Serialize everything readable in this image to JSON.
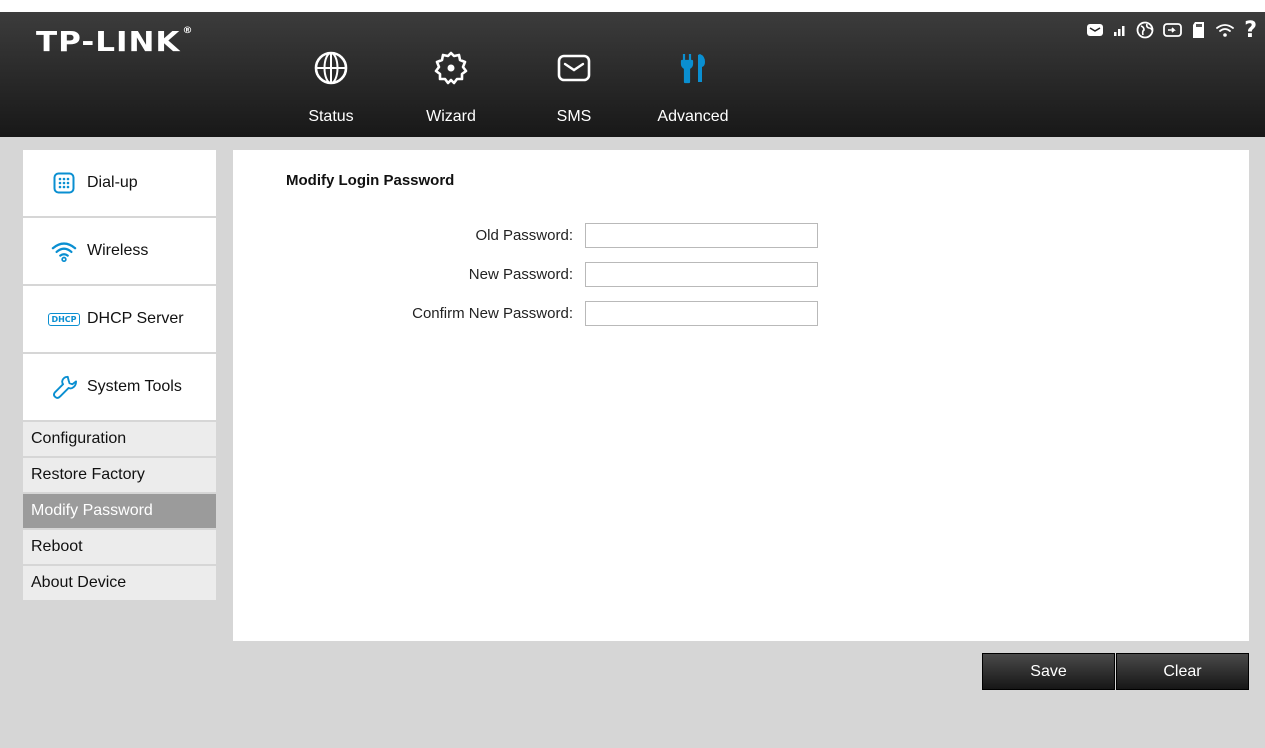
{
  "brand": {
    "logo_text": "TP-LINK",
    "logo_mark": "®"
  },
  "nav": [
    {
      "id": "status",
      "label": "Status",
      "icon": "globe-icon"
    },
    {
      "id": "wizard",
      "label": "Wizard",
      "icon": "gear-icon"
    },
    {
      "id": "sms",
      "label": "SMS",
      "icon": "envelope-icon"
    },
    {
      "id": "advanced",
      "label": "Advanced",
      "icon": "tools-icon",
      "active": true
    }
  ],
  "status_icons": [
    "message-icon",
    "signal-icon",
    "internet-icon",
    "battery-icon",
    "sd-card-icon",
    "wifi-icon",
    "help-icon"
  ],
  "sidebar": {
    "items": [
      {
        "label": "Dial-up",
        "icon": "dialpad-icon"
      },
      {
        "label": "Wireless",
        "icon": "wifi-icon"
      },
      {
        "label": "DHCP Server",
        "icon": "dhcp-icon",
        "icon_text": "DHCP"
      },
      {
        "label": "System Tools",
        "icon": "wrench-icon"
      }
    ],
    "submenu": [
      {
        "label": "Configuration"
      },
      {
        "label": "Restore Factory"
      },
      {
        "label": "Modify Password",
        "active": true
      },
      {
        "label": "Reboot"
      },
      {
        "label": "About Device"
      }
    ]
  },
  "main": {
    "title": "Modify Login Password",
    "fields": [
      {
        "label": "Old Password:",
        "value": ""
      },
      {
        "label": "New Password:",
        "value": ""
      },
      {
        "label": "Confirm New Password:",
        "value": ""
      }
    ]
  },
  "actions": {
    "save_label": "Save",
    "clear_label": "Clear"
  },
  "colors": {
    "header_dark": "#181818",
    "page_bg": "#d6d6d6",
    "submenu_bg": "#ececec",
    "submenu_active": "#9b9b9b",
    "icon_accent": "#0a8fd1"
  }
}
